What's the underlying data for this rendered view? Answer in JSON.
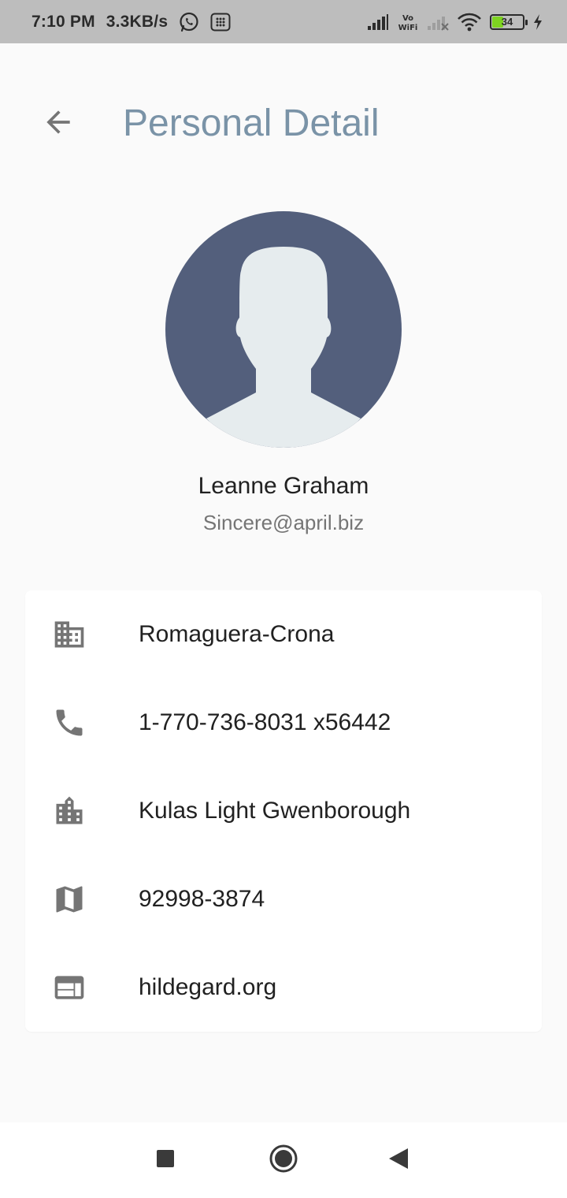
{
  "status_bar": {
    "time": "7:10 PM",
    "speed": "3.3KB/s",
    "battery_level": "34",
    "battery_fraction": 0.34,
    "icons": [
      "whatsapp-icon",
      "notification-icon",
      "signal-icon",
      "vowifi-icon",
      "signal-off-icon",
      "wifi-icon",
      "battery-icon",
      "charging-icon"
    ]
  },
  "app_bar": {
    "title": "Personal Detail",
    "back_icon": "arrow-back-icon"
  },
  "profile": {
    "name": "Leanne Graham",
    "email": "Sincere@april.biz"
  },
  "details": [
    {
      "icon": "business-icon",
      "value": "Romaguera-Crona"
    },
    {
      "icon": "phone-icon",
      "value": "1-770-736-8031 x56442"
    },
    {
      "icon": "location-city-icon",
      "value": "Kulas Light Gwenborough"
    },
    {
      "icon": "map-icon",
      "value": "92998-3874"
    },
    {
      "icon": "web-icon",
      "value": "hildegard.org"
    }
  ],
  "nav_bar": {
    "icons": [
      "recents-square-icon",
      "home-circle-icon",
      "back-triangle-icon"
    ]
  },
  "colors": {
    "status_bar_bg": "#bdbdbd",
    "title": "#7a93a7",
    "avatar_bg": "#535f7c",
    "avatar_figure": "#e6ecee",
    "icon_gray": "#757575",
    "battery_green": "#7ed321"
  }
}
